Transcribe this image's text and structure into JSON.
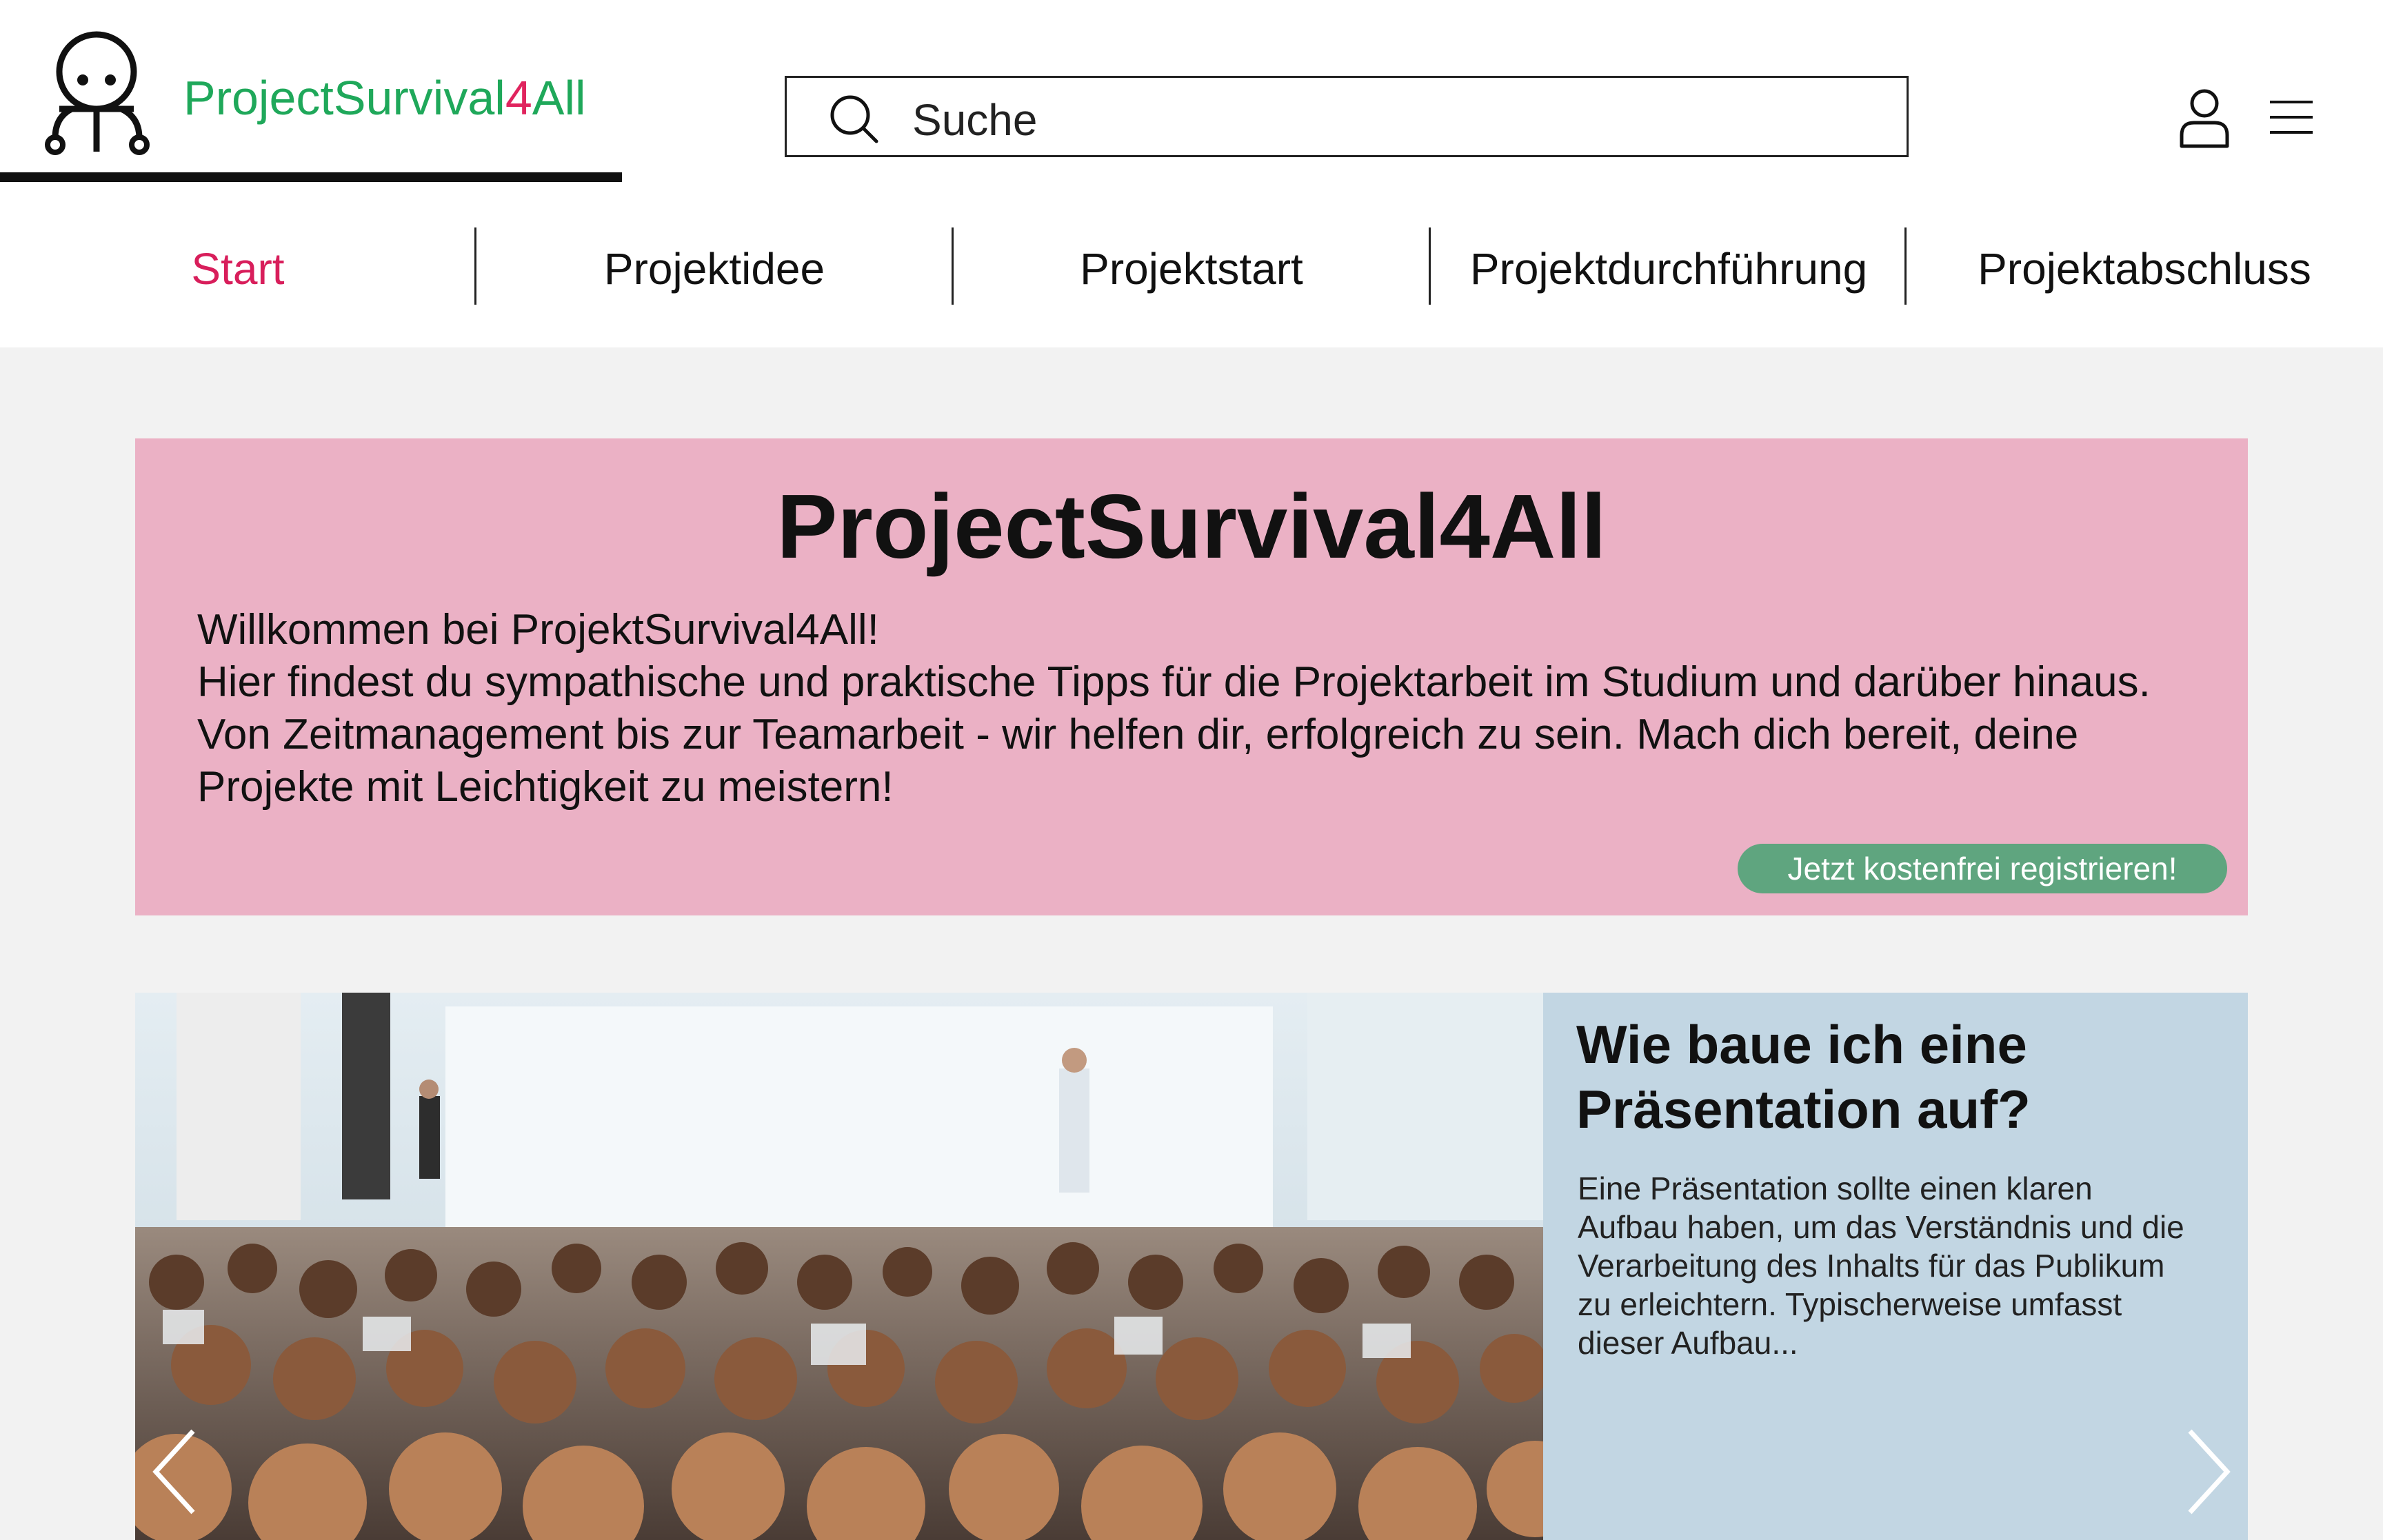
{
  "header": {
    "brand": {
      "name_part1": "ProjectSurvival",
      "name_digit": "4",
      "name_part2": "All"
    },
    "search": {
      "placeholder": "Suche"
    },
    "icons": {
      "logo": "octopus-logo-icon",
      "search": "search-icon",
      "user": "user-icon",
      "menu": "hamburger-menu-icon"
    }
  },
  "nav": {
    "items": [
      {
        "label": "Start",
        "active": true
      },
      {
        "label": "Projektidee",
        "active": false
      },
      {
        "label": "Projektstart",
        "active": false
      },
      {
        "label": "Projektdurchführung",
        "active": false
      },
      {
        "label": "Projektabschluss",
        "active": false
      }
    ]
  },
  "hero": {
    "title": "ProjectSurvival4All",
    "paragraph1": "Willkommen bei ProjektSurvival4All!",
    "paragraph2": "Hier findest du sympathische und praktische Tipps für die Projektarbeit im Studium und darüber hinaus. Von Zeitmanagement bis zur Teamarbeit - wir helfen dir, erfolgreich zu sein. Mach dich bereit, deine Projekte mit Leichtigkeit zu meistern!",
    "cta": "Jetzt kostenfrei registrieren!"
  },
  "carousel": {
    "article_title": "Wie baue ich eine Präsentation auf?",
    "article_text": "Eine Präsentation sollte einen klaren Aufbau haben, um das Verständnis und die Verarbeitung des Inhalts für das Publikum zu erleichtern. Typischerweise umfasst dieser Aufbau...",
    "image": "conference-audience-photo"
  },
  "colors": {
    "brand_green": "#1fa85a",
    "brand_pink": "#e0245e",
    "nav_active": "#d81e5b",
    "hero_bg": "#ebb1c5",
    "cta_bg": "#5fa57f",
    "carousel_bg": "#c2d6e3",
    "page_bg": "#f2f2f2"
  }
}
